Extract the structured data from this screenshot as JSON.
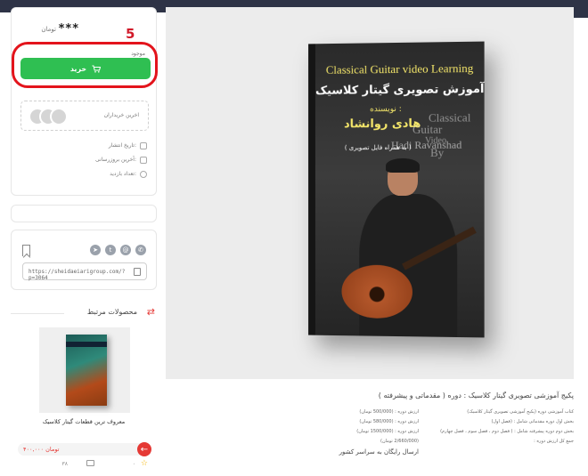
{
  "sidebar": {
    "price": {
      "value": "***",
      "unit": "تومان"
    },
    "annotation_number": "5",
    "stock_label": "موجود",
    "buy_button_label": "خرید",
    "buyers_label": "اخرین خریداران",
    "meta": [
      {
        "label": "تاریخ انتشار:",
        "icon": "calendar-icon"
      },
      {
        "label": "آخرین بروزرسانی:",
        "icon": "calendar-icon"
      },
      {
        "label": "تعداد بازدید:",
        "icon": "eye-icon"
      }
    ],
    "short_url": "https://sheidaeiarigroup.com/?p=3064",
    "share_icons": [
      "telegram-icon",
      "twitter-icon",
      "email-icon",
      "whatsapp-icon"
    ],
    "related": {
      "title": "محصولات مرتبط",
      "item_name": "معروف ترین قطعات گیتار کلاسیک",
      "price": "۴۰۰,۰۰۰ تومان",
      "stat_a": "۰",
      "stat_b": "۳۸"
    }
  },
  "hero": {
    "book_title_en": "Classical Guitar video Learning",
    "book_title_fa": "آموزش تصویری گیتار کلاسیک",
    "author_label": "نویسنده :",
    "author_name": "هادی روانشاد",
    "note": "( به همراه فایل تصویری )",
    "ghost_lines": [
      "Classical",
      "Guitar",
      "Video",
      "By"
    ],
    "ghost_name": "Hadi Ravanshad"
  },
  "description": {
    "title": "پکیج آموزشی تصویری گیتار کلاسیک : دوره ( مقدماتی و پیشرفته )",
    "lines_right": [
      "کتاب آموزشی دوره (پکیج آموزشی تصویری گیتار کلاسیک)",
      "بخش اول دوره مقدماتی شامل : (فصل اول)",
      "بخش دوم دوره پیشرفته شامل : ( فصل دوم ، فصل سوم ، فصل چهارم)",
      "جمع کل ارزش دوره :"
    ],
    "lines_left": [
      "ارزش دوره : (500/000 تومان)",
      "ارزش دوره : (580/000 تومان)",
      "ارزش دوره : (1500/000 تومان)",
      "(2/660/000 تومان)"
    ],
    "footer": "ارسال رایگان به سراسر کشور"
  },
  "colors": {
    "buy_green": "#2fbf52",
    "annotation_red": "#e3141c",
    "accent_red": "#e53935",
    "band": "#2e3346"
  }
}
